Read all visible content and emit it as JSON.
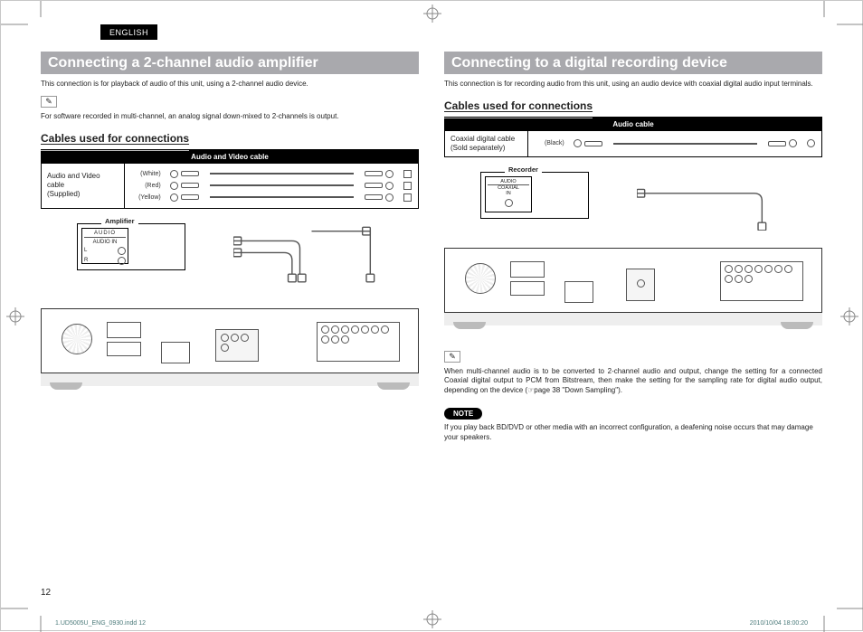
{
  "lang_tag": "ENGLISH",
  "page_number": "12",
  "indd": {
    "file": "1.UD5005U_ENG_0930.indd   12",
    "timestamp": "2010/10/04   18:00:20"
  },
  "left": {
    "heading": "Connecting a 2-channel audio amplifier",
    "intro": "This connection is for playback of audio of this unit, using a 2-channel audio device.",
    "pencil_note": "For software recorded in multi-channel, an analog signal down-mixed to 2-channels is output.",
    "subhead": "Cables used for connections",
    "table_title": "Audio and Video cable",
    "cable_desc_line1": "Audio and Video cable",
    "cable_desc_line2": "(Supplied)",
    "rows": [
      {
        "label": "(White)"
      },
      {
        "label": "(Red)"
      },
      {
        "label": "(Yellow)"
      }
    ],
    "amp_label": "Amplifier",
    "amp_inner_top": "AUDIO",
    "amp_inner_sub": "AUDIO IN",
    "amp_l": "L",
    "amp_r": "R"
  },
  "right": {
    "heading": "Connecting to a digital recording device",
    "intro": "This connection is for recording audio from this unit, using an audio device with coaxial digital audio input terminals.",
    "subhead": "Cables used for connections",
    "table_title": "Audio cable",
    "cable_desc_line1": "Coaxial digital cable",
    "cable_desc_line2": "(Sold separately)",
    "row_label": "(Black)",
    "rec_label": "Recorder",
    "rec_inner_l1": "AUDIO",
    "rec_inner_l2": "COAXIAL",
    "rec_inner_l3": "IN",
    "pencil_note": "When multi-channel audio is to be converted to 2-channel audio and output, change the setting for a connected Coaxial digital output to PCM from Bitstream, then make the setting for the sampling rate for digital audio output, depending on the device (☞page 38 \"Down Sampling\").",
    "note_label": "NOTE",
    "note_text": "If you play back BD/DVD or other media with an incorrect configuration, a deafening noise occurs that may damage your speakers."
  }
}
